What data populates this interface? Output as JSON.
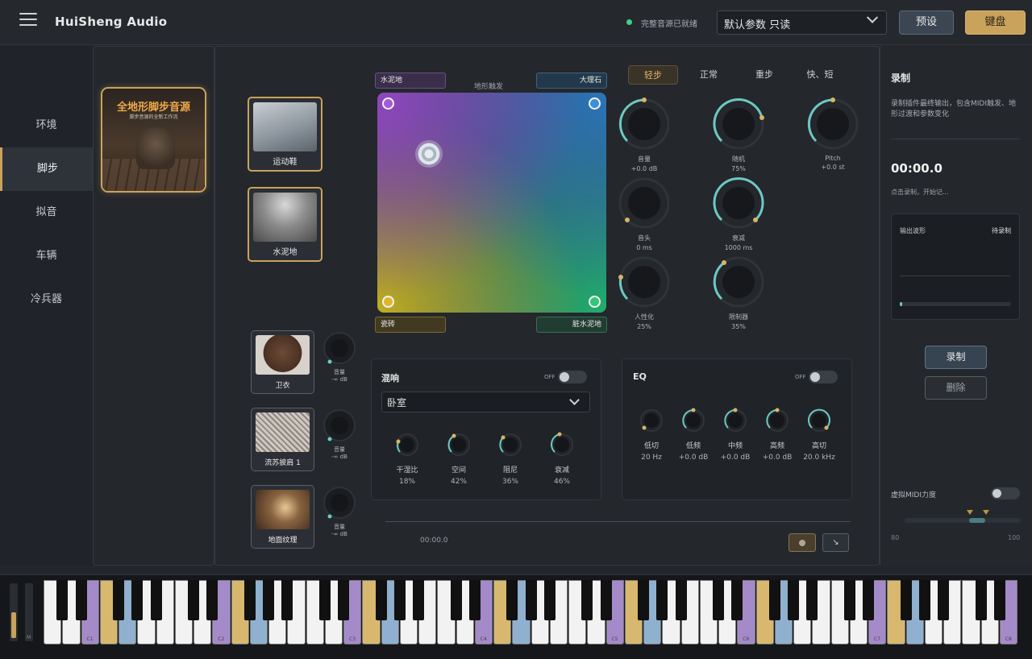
{
  "header": {
    "brand": "HuiSheng   Audio",
    "status_text": "完整音源已就绪",
    "preset_value": "默认参数  只读",
    "preset_button": "预设",
    "keyboard_button": "键盘"
  },
  "sidebar": {
    "items": [
      {
        "label": "环境"
      },
      {
        "label": "脚步"
      },
      {
        "label": "拟音"
      },
      {
        "label": "车辆"
      },
      {
        "label": "冷兵器"
      }
    ],
    "active": "脚步"
  },
  "library": {
    "cover_title": "全地形脚步音源",
    "cover_subtitle": "脚步音源的全新工作流"
  },
  "shoe_tiles": [
    {
      "label": "运动鞋"
    },
    {
      "label": "水泥地"
    }
  ],
  "cloth_tiles": [
    {
      "label": "卫衣",
      "vol_label": "音量",
      "vol_value": "-∞ dB"
    },
    {
      "label": "流苏披肩 1",
      "vol_label": "音量",
      "vol_value": "-∞ dB"
    },
    {
      "label": "地面纹理",
      "vol_label": "音量",
      "vol_value": "-∞ dB"
    }
  ],
  "xy_pad": {
    "title": "地形触发",
    "top_left": "水泥地",
    "top_right": "大理石",
    "bottom_left": "瓷砖",
    "bottom_right": "脏水泥地",
    "colors": {
      "top_left": "#a55ad6",
      "top_right": "#3c8ed6",
      "bottom_left": "#e0b52a",
      "bottom_right": "#35c57a"
    }
  },
  "step_tabs": [
    {
      "label": "轻步"
    },
    {
      "label": "正常"
    },
    {
      "label": "重步"
    },
    {
      "label": "快、短"
    }
  ],
  "knobs": [
    {
      "label": "音量",
      "value": "+0.0 dB"
    },
    {
      "label": "随机",
      "value": "75%"
    },
    {
      "label": "Pitch",
      "value": "+0.0 st"
    },
    {
      "label": "音头",
      "value": "0 ms"
    },
    {
      "label": "衰减",
      "value": "1000 ms"
    },
    {
      "label": "人性化",
      "value": "25%"
    },
    {
      "label": "限制器",
      "value": "35%"
    }
  ],
  "reverb": {
    "title": "混响",
    "toggle": "OFF",
    "room": "卧室",
    "knobs": [
      {
        "label": "干湿比",
        "value": "18%"
      },
      {
        "label": "空间",
        "value": "42%"
      },
      {
        "label": "阻尼",
        "value": "36%"
      },
      {
        "label": "衰减",
        "value": "46%"
      }
    ]
  },
  "eq": {
    "title": "EQ",
    "toggle": "OFF",
    "knobs": [
      {
        "label": "低切",
        "value": "20 Hz"
      },
      {
        "label": "低频",
        "value": "+0.0 dB"
      },
      {
        "label": "中频",
        "value": "+0.0 dB"
      },
      {
        "label": "高频",
        "value": "+0.0 dB"
      },
      {
        "label": "高切",
        "value": "20.0 kHz"
      }
    ]
  },
  "transport": {
    "time": "00:00.0"
  },
  "recorder": {
    "title": "录制",
    "description": "录制插件最终输出，包含MIDI触发、地形过渡和参数变化",
    "time": "00:00.0",
    "hint": "点击录制，开始记...",
    "waveform_label": "输出波形",
    "waveform_status": "待录制",
    "record_button": "录制",
    "delete_button": "删除",
    "velocity_label": "虚拟MIDI力度",
    "vel_min": "80",
    "vel_max": "100"
  },
  "keyboard": {
    "octave_labels": [
      "C1",
      "C2",
      "C3",
      "C4",
      "C5",
      "C6",
      "C7",
      "C8"
    ],
    "m_label": "M",
    "colors": {
      "purple": "#a58ac9",
      "gold": "#d7b86e",
      "blue": "#8fb1cf"
    }
  }
}
